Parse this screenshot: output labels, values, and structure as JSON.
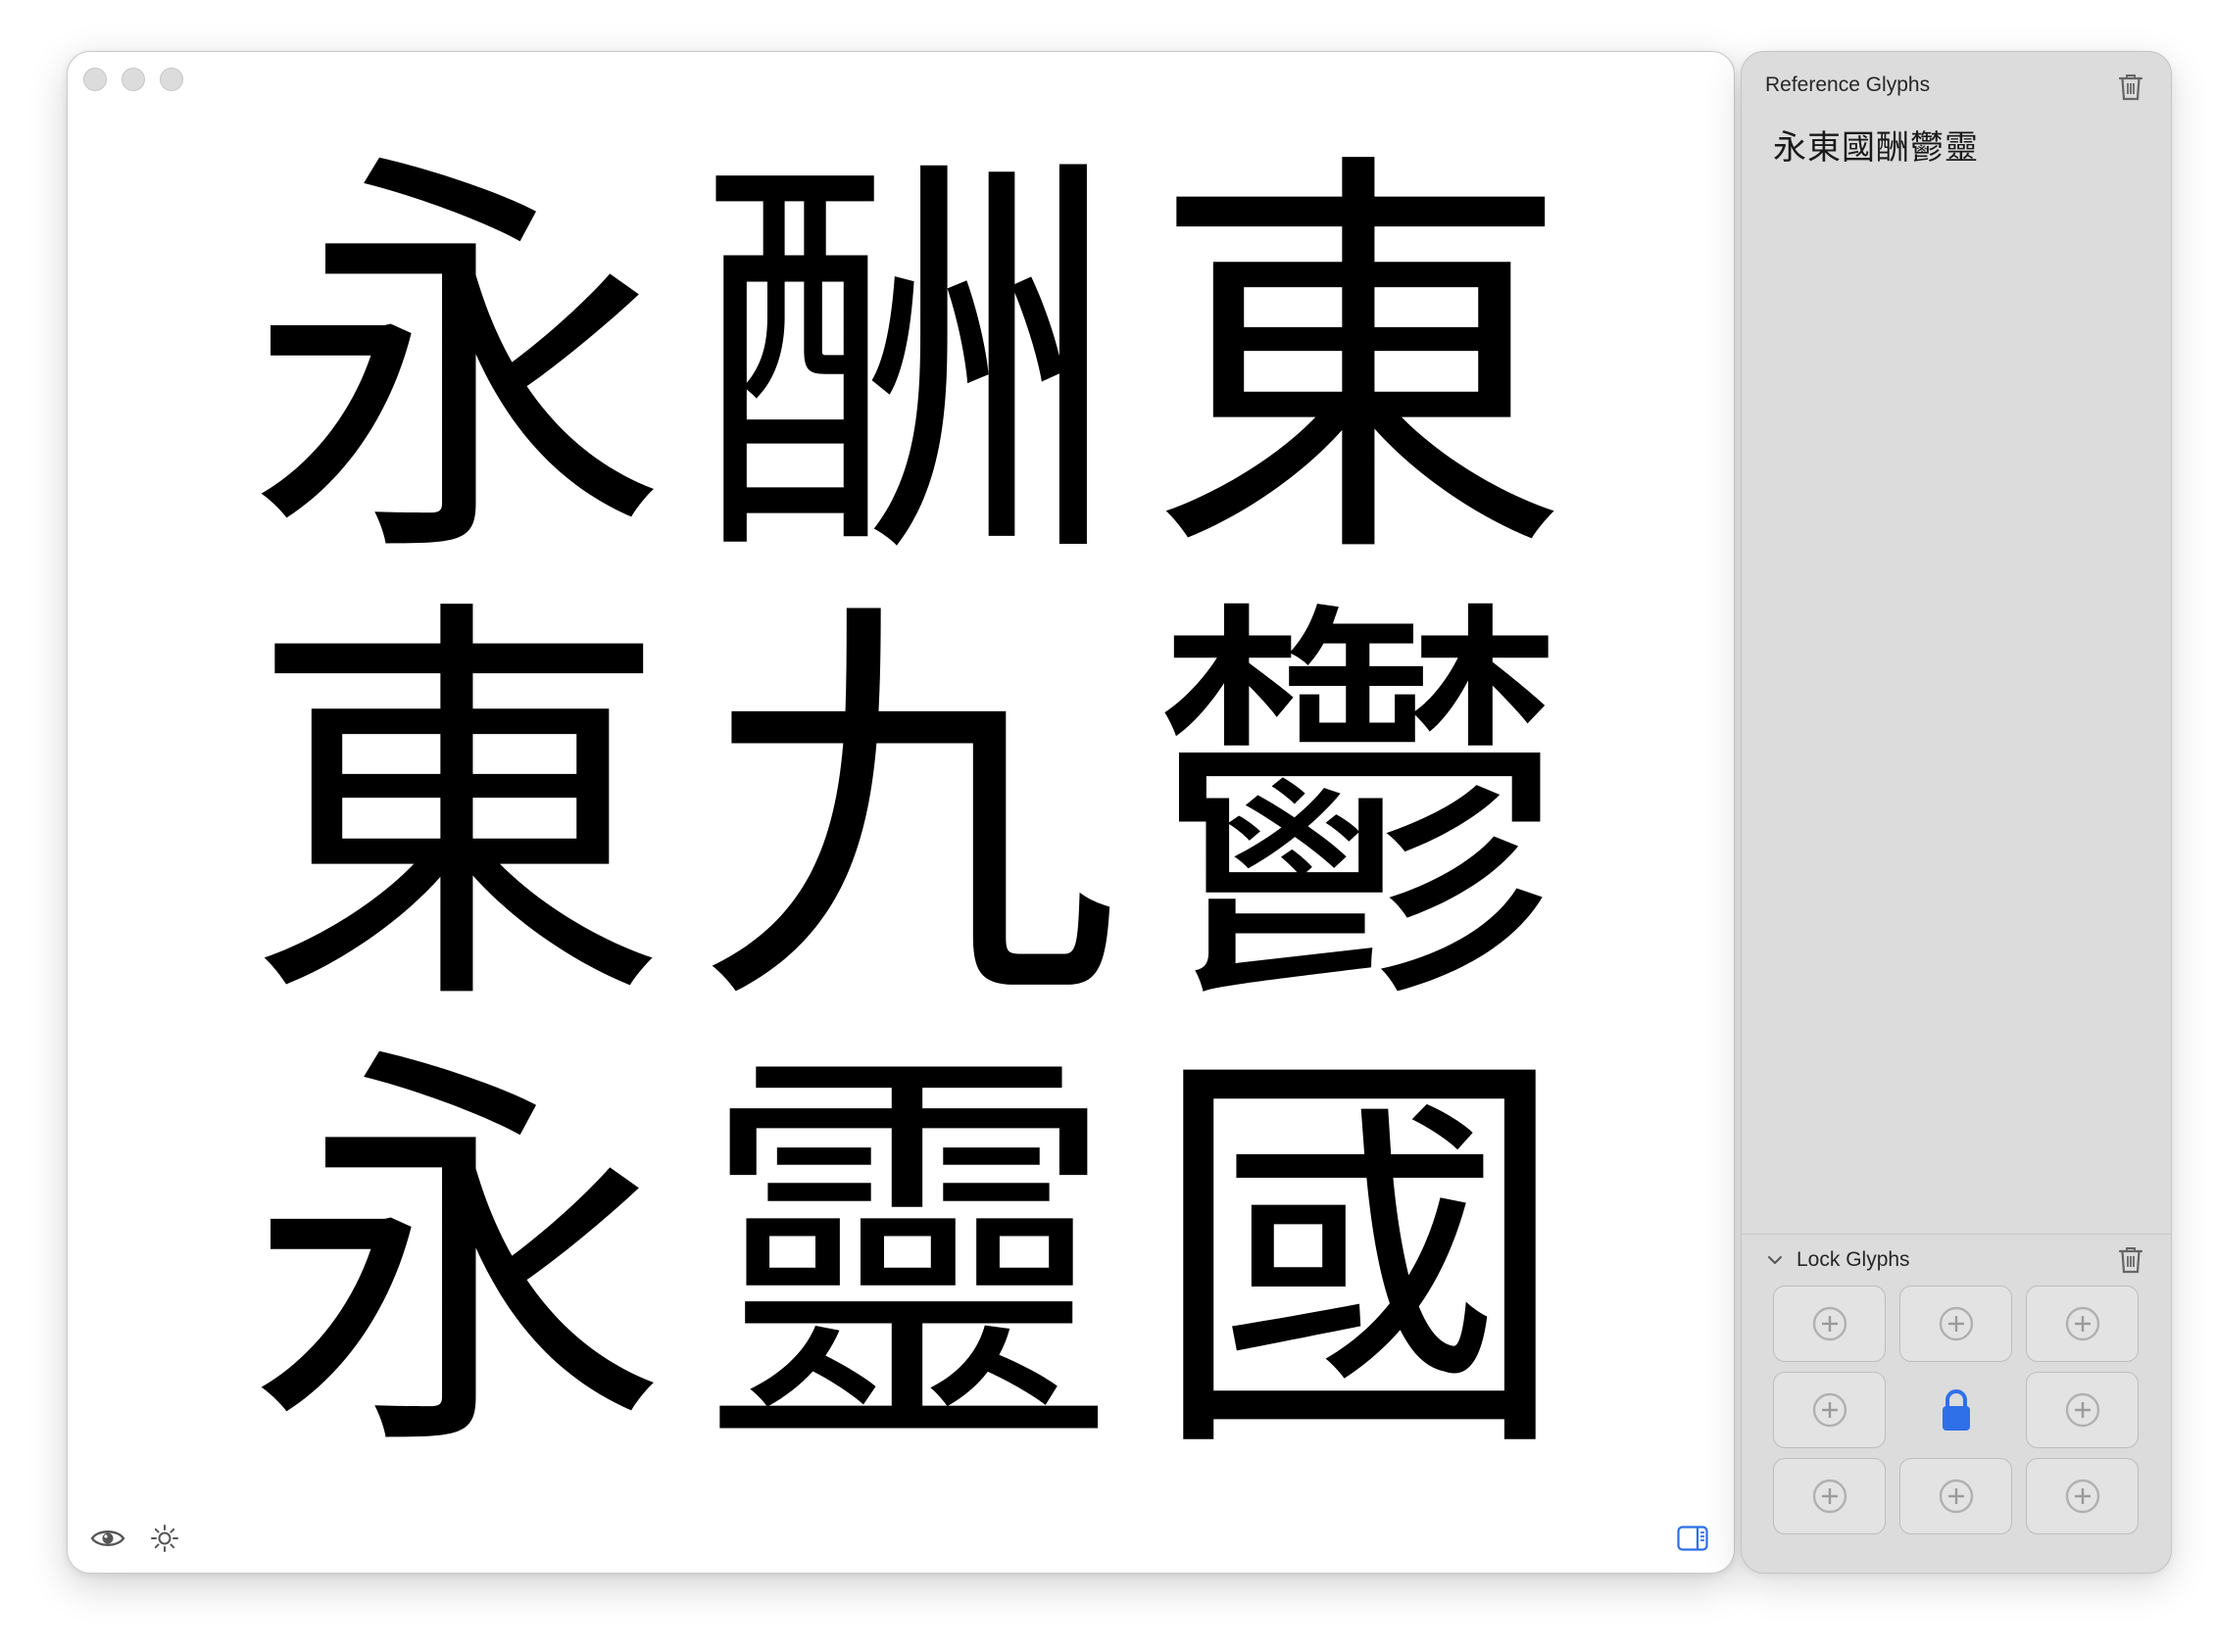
{
  "main_window": {
    "traffic_lights": [
      "close",
      "minimize",
      "zoom"
    ],
    "glyph_grid": [
      "永",
      "酬",
      "東",
      "東",
      "九",
      "鬱",
      "永",
      "靈",
      "國"
    ],
    "bottom_tools": {
      "preview_icon": "eye-icon",
      "appearance_icon": "sun-icon",
      "sidebar_icon": "sidebar-toggle-icon"
    }
  },
  "side_panel": {
    "reference": {
      "title": "Reference Glyphs",
      "glyphs": "永東國酬鬱靈",
      "trash_icon": "trash-icon"
    },
    "lock": {
      "title": "Lock Glyphs",
      "expanded": true,
      "chevron_icon": "chevron-down-icon",
      "trash_icon": "trash-icon",
      "slots": [
        {
          "state": "empty",
          "icon": "plus-circle-icon"
        },
        {
          "state": "empty",
          "icon": "plus-circle-icon"
        },
        {
          "state": "empty",
          "icon": "plus-circle-icon"
        },
        {
          "state": "empty",
          "icon": "plus-circle-icon"
        },
        {
          "state": "locked",
          "icon": "lock-icon"
        },
        {
          "state": "empty",
          "icon": "plus-circle-icon"
        },
        {
          "state": "empty",
          "icon": "plus-circle-icon"
        },
        {
          "state": "empty",
          "icon": "plus-circle-icon"
        },
        {
          "state": "empty",
          "icon": "plus-circle-icon"
        }
      ]
    }
  },
  "colors": {
    "accent": "#2f6fe8",
    "panel_bg": "#dcdcdc",
    "window_bg": "#ffffff"
  }
}
